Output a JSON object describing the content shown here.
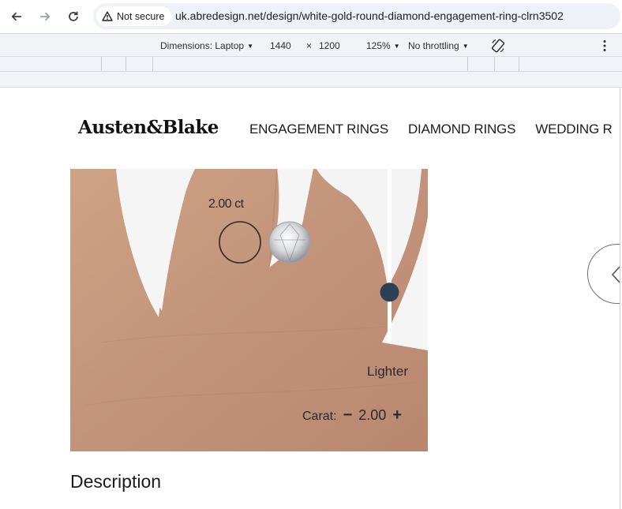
{
  "browser": {
    "security_label": "Not secure",
    "url": "uk.abredesign.net/design/white-gold-round-diamond-engagement-ring-clrn3502",
    "icons": [
      "back-arrow-icon",
      "forward-arrow-icon",
      "reload-icon",
      "warning-triangle-icon"
    ]
  },
  "devtools": {
    "dimensions_label": "Dimensions: Laptop",
    "width": "1440",
    "times": "×",
    "height": "1200",
    "zoom": "125%",
    "throttling": "No throttling",
    "icons": [
      "rotate-icon",
      "more-vert-icon",
      "dropdown-caret-icon"
    ]
  },
  "site": {
    "logo": "Austen&Blake",
    "nav": [
      "ENGAGEMENT RINGS",
      "DIAMOND RINGS",
      "WEDDING R"
    ],
    "hero": {
      "carat_marker_label": "2.00 ct",
      "slider_label": "Lighter",
      "slider_value": 0.74,
      "carat_label": "Carat:",
      "minus": "−",
      "carat_value": "2.00",
      "plus": "+"
    },
    "description_title": "Description",
    "colors": {
      "slider_thumb": "#2b3f57",
      "skin": "#c49679"
    }
  }
}
